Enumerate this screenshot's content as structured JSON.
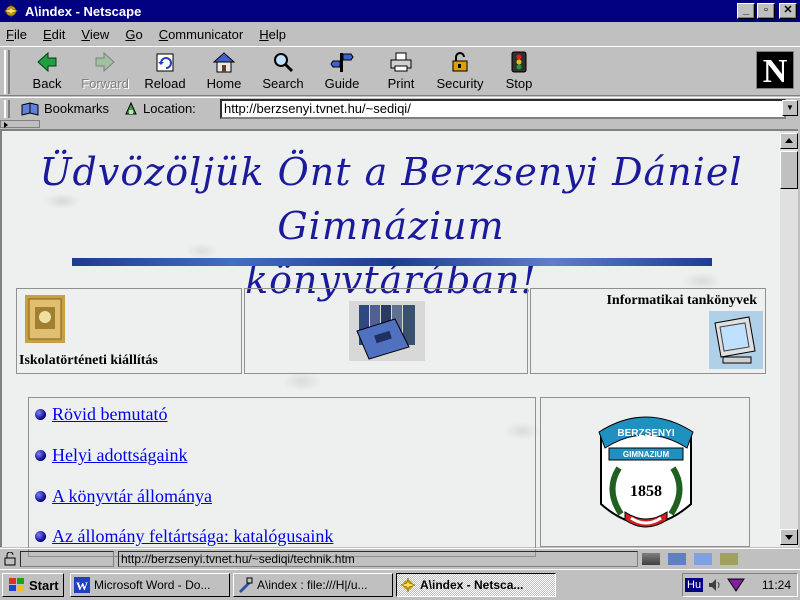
{
  "window": {
    "title": "A\\index - Netscape",
    "controls": {
      "minimize": "_",
      "maximize": "▫",
      "close": "✕"
    }
  },
  "menu": [
    "File",
    "Edit",
    "View",
    "Go",
    "Communicator",
    "Help"
  ],
  "toolbar": {
    "buttons": [
      {
        "label": "Back",
        "icon": "back-arrow-icon"
      },
      {
        "label": "Forward",
        "icon": "forward-arrow-icon",
        "disabled": true
      },
      {
        "label": "Reload",
        "icon": "reload-icon"
      },
      {
        "label": "Home",
        "icon": "home-icon"
      },
      {
        "label": "Search",
        "icon": "search-icon"
      },
      {
        "label": "Guide",
        "icon": "guide-icon"
      },
      {
        "label": "Print",
        "icon": "printer-icon"
      },
      {
        "label": "Security",
        "icon": "padlock-icon"
      },
      {
        "label": "Stop",
        "icon": "stop-icon"
      }
    ],
    "logo": "N"
  },
  "location": {
    "bookmarks_label": "Bookmarks",
    "location_label": "Location:",
    "url": "http://berzsenyi.tvnet.hu/~sediqi/"
  },
  "page": {
    "heading_line1": "Üdvözöljük Önt a Berzsenyi Dániel Gimnázium",
    "heading_line2": "könyvtárában!",
    "features": {
      "left": "Iskolatörténeti kiállítás",
      "right": "Informatikai tankönyvek"
    },
    "links": [
      "Rövid bemutató",
      "Helyi adottságaink",
      "A könyvtár állománya",
      "Az állomány feltártsága: katalógusaink"
    ],
    "logo": {
      "arc_text": "BERZSENYI",
      "sub_text": "GIMNAZIUM",
      "year": "1858"
    }
  },
  "status": {
    "text": "http://berzsenyi.tvnet.hu/~sediqi/technik.htm"
  },
  "taskbar": {
    "start": "Start",
    "tasks": [
      "Microsoft Word - Do...",
      "A\\index : file:///H|/u...",
      "A\\index - Netsca..."
    ],
    "lang": "Hu",
    "clock": "11:24"
  }
}
